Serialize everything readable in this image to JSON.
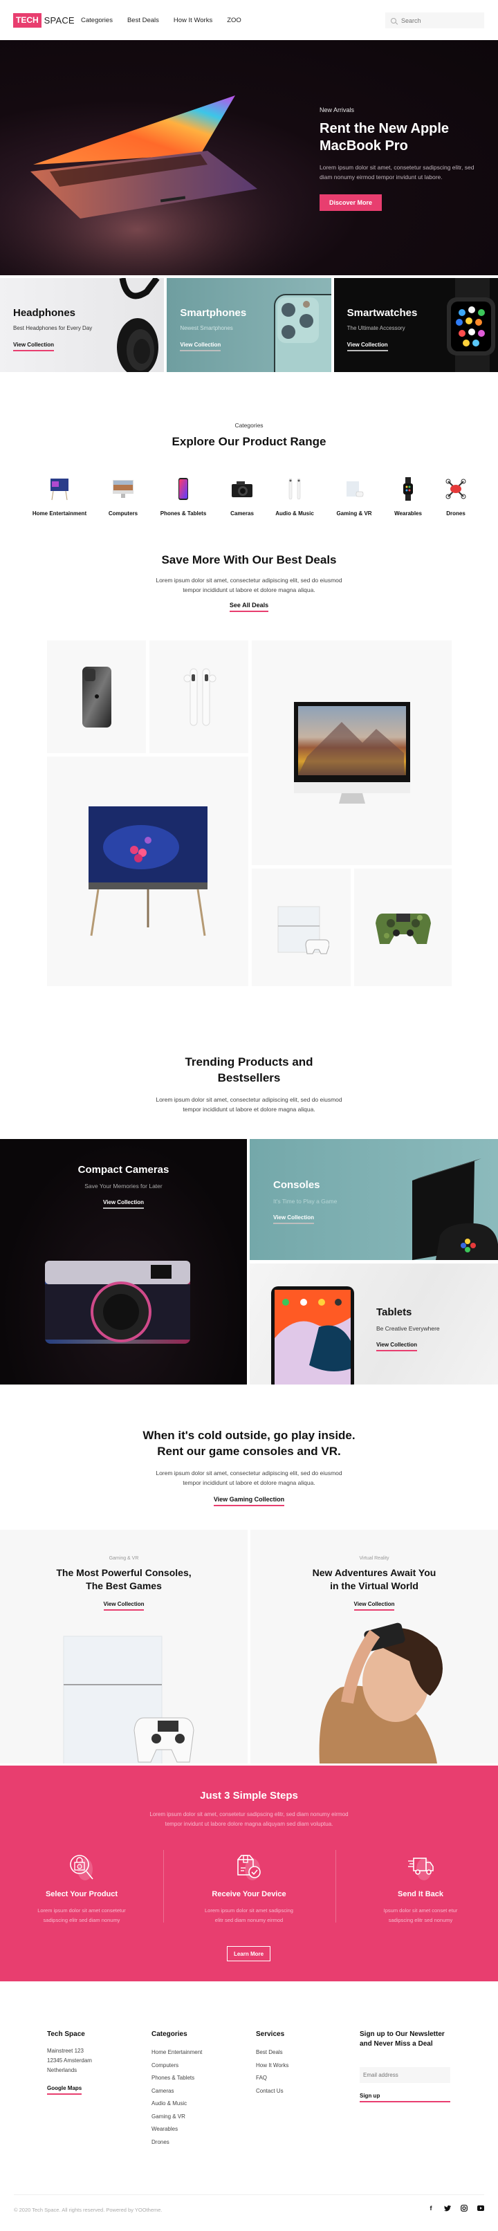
{
  "header": {
    "logo_left": "TECH",
    "logo_right": "SPACE",
    "nav": [
      "Categories",
      "Best Deals",
      "How It Works",
      "ZOO"
    ],
    "search_placeholder": "Search"
  },
  "hero": {
    "eyebrow": "New Arrivals",
    "title_line1": "Rent the New Apple",
    "title_line2": "MacBook Pro",
    "description": "Lorem ipsum dolor sit amet, consetetur sadipscing elitr, sed diam nonumy eirmod tempor invidunt ut labore.",
    "button": "Discover More"
  },
  "tiles": [
    {
      "title": "Headphones",
      "subtitle": "Best Headphones for Every Day",
      "link": "View Collection"
    },
    {
      "title": "Smartphones",
      "subtitle": "Newest Smartphones",
      "link": "View Collection"
    },
    {
      "title": "Smartwatches",
      "subtitle": "The Ultimate Accessory",
      "link": "View Collection"
    }
  ],
  "categories": {
    "eyebrow": "Categories",
    "title": "Explore Our Product Range",
    "items": [
      "Home Entertainment",
      "Computers",
      "Phones & Tablets",
      "Cameras",
      "Audio & Music",
      "Gaming & VR",
      "Wearables",
      "Drones"
    ]
  },
  "deals": {
    "title": "Save More With Our Best Deals",
    "description": "Lorem ipsum dolor sit amet, consectetur adipiscing elit, sed do eiusmod tempor incididunt ut labore et dolore magna aliqua.",
    "link": "See All Deals",
    "products": [
      "iPhone",
      "AirPods",
      "iMac",
      "TV",
      "PlayStation",
      "Controller"
    ]
  },
  "trending": {
    "title_line1": "Trending Products and",
    "title_line2": "Bestsellers",
    "description": "Lorem ipsum dolor sit amet, consectetur adipiscing elit, sed do eiusmod tempor incididunt ut labore et dolore magna aliqua.",
    "cards": [
      {
        "title": "Compact Cameras",
        "subtitle": "Save Your Memories for Later",
        "link": "View Collection"
      },
      {
        "title": "Consoles",
        "subtitle": "It's Time to Play a Game",
        "link": "View Collection"
      },
      {
        "title": "Tablets",
        "subtitle": "Be Creative Everywhere",
        "link": "View Collection"
      }
    ]
  },
  "gaming": {
    "title_line1": "When it's cold outside, go play inside.",
    "title_line2": "Rent our game consoles and VR.",
    "description": "Lorem ipsum dolor sit amet, consectetur adipiscing elit, sed do eiusmod tempor incididunt ut labore et dolore magna aliqua.",
    "link": "View Gaming Collection",
    "cards": [
      {
        "eyebrow": "Gaming & VR",
        "title_line1": "The Most Powerful Consoles,",
        "title_line2": "The Best Games",
        "link": "View Collection"
      },
      {
        "eyebrow": "Virtual Reality",
        "title_line1": "New Adventures Await You",
        "title_line2": "in the Virtual World",
        "link": "View Collection"
      }
    ]
  },
  "steps": {
    "title": "Just 3 Simple Steps",
    "description": "Lorem ipsum dolor sit amet, consetetur sadipscing elitr, sed diam nonumy eirmod tempor invidunt ut labore dolore magna aliquyam sed diam voluptua.",
    "items": [
      {
        "icon": "shopping-bag-search-icon",
        "title": "Select Your Product",
        "desc_line1": "Lorem ipsum dolor sit amet consetetur",
        "desc_line2": "sadipscing elitr sed diam nonumy"
      },
      {
        "icon": "package-check-icon",
        "title": "Receive Your Device",
        "desc_line1": "Lorem ipsum dolor sit amet sadipscing",
        "desc_line2": "elitr sed diam nonumy eirmod"
      },
      {
        "icon": "delivery-truck-icon",
        "title": "Send It Back",
        "desc_line1": "Ipsum dolor sit amet conset etur",
        "desc_line2": "sadipscing elitr sed nonumy"
      }
    ],
    "button": "Learn More",
    "accent": "#e83e6f"
  },
  "footer": {
    "company": {
      "title": "Tech Space",
      "address": [
        "Mainstreet 123",
        "12345 Amsterdam",
        "Netherlands"
      ],
      "link": "Google Maps"
    },
    "categories": {
      "title": "Categories",
      "items": [
        "Home Entertainment",
        "Computers",
        "Phones & Tablets",
        "Cameras",
        "Audio & Music",
        "Gaming & VR",
        "Wearables",
        "Drones"
      ]
    },
    "services": {
      "title": "Services",
      "items": [
        "Best Deals",
        "How It Works",
        "FAQ",
        "Contact Us"
      ]
    },
    "newsletter": {
      "title_line1": "Sign up to Our Newsletter",
      "title_line2": "and Never Miss a Deal",
      "email_placeholder": "Email address",
      "button": "Sign up"
    },
    "copyright": "© 2020 Tech Space. All rights reserved. Powered by YOOtheme.",
    "socials": [
      "facebook",
      "twitter",
      "instagram",
      "youtube"
    ]
  }
}
